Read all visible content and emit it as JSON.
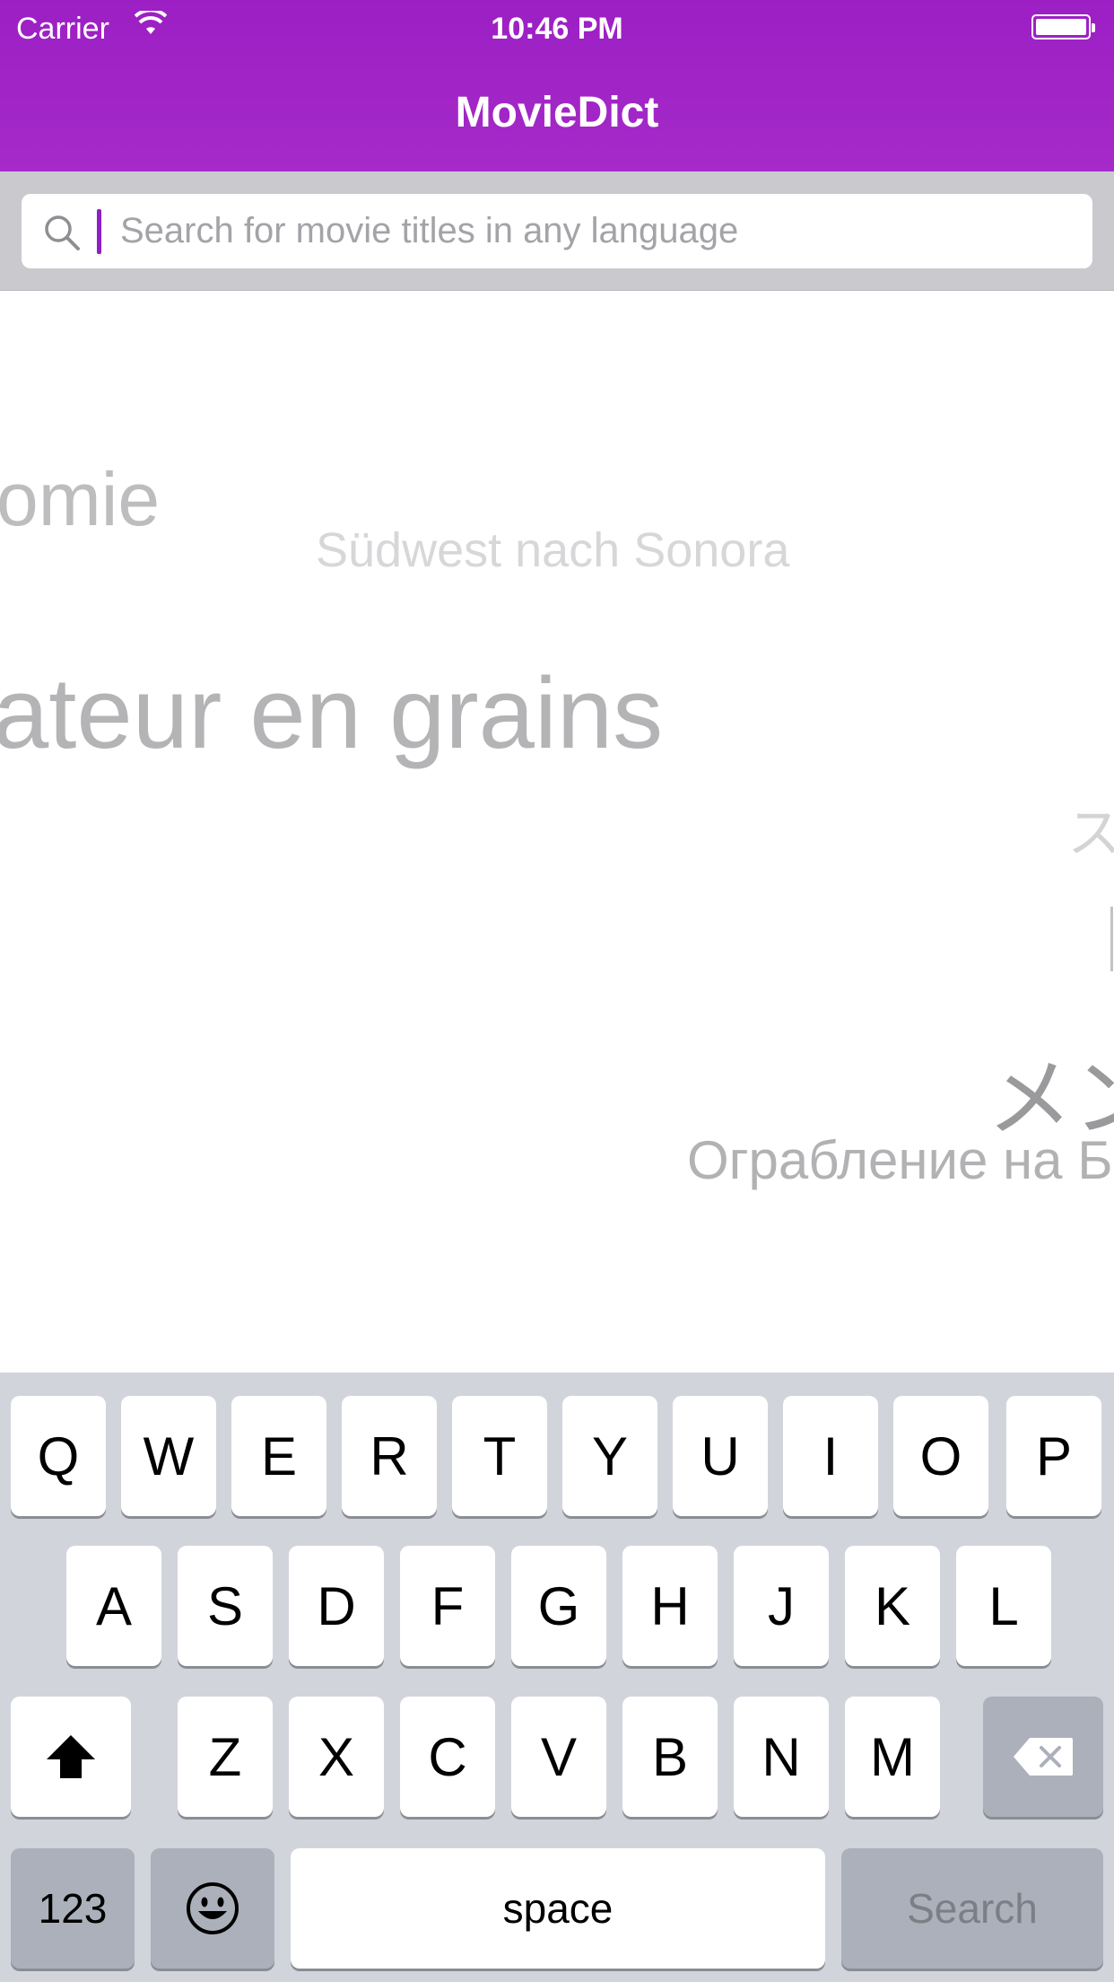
{
  "status_bar": {
    "carrier": "Carrier",
    "time": "10:46 PM"
  },
  "nav": {
    "title": "MovieDict"
  },
  "search": {
    "placeholder": "Search for movie titles in any language",
    "value": ""
  },
  "background_titles": [
    "omie",
    "Südwest nach Sonora",
    "ateur en grains",
    "ス",
    "メン",
    "Ограбление на Б"
  ],
  "keyboard": {
    "row1": [
      "Q",
      "W",
      "E",
      "R",
      "T",
      "Y",
      "U",
      "I",
      "O",
      "P"
    ],
    "row2": [
      "A",
      "S",
      "D",
      "F",
      "G",
      "H",
      "J",
      "K",
      "L"
    ],
    "row3": [
      "Z",
      "X",
      "C",
      "V",
      "B",
      "N",
      "M"
    ],
    "numbers_label": "123",
    "space_label": "space",
    "search_label": "Search",
    "shift_icon": "shift-icon",
    "delete_icon": "delete-icon",
    "emoji_icon": "emoji-icon"
  },
  "colors": {
    "accent": "#9c1fc4",
    "keyboard_bg": "#d1d5db"
  }
}
